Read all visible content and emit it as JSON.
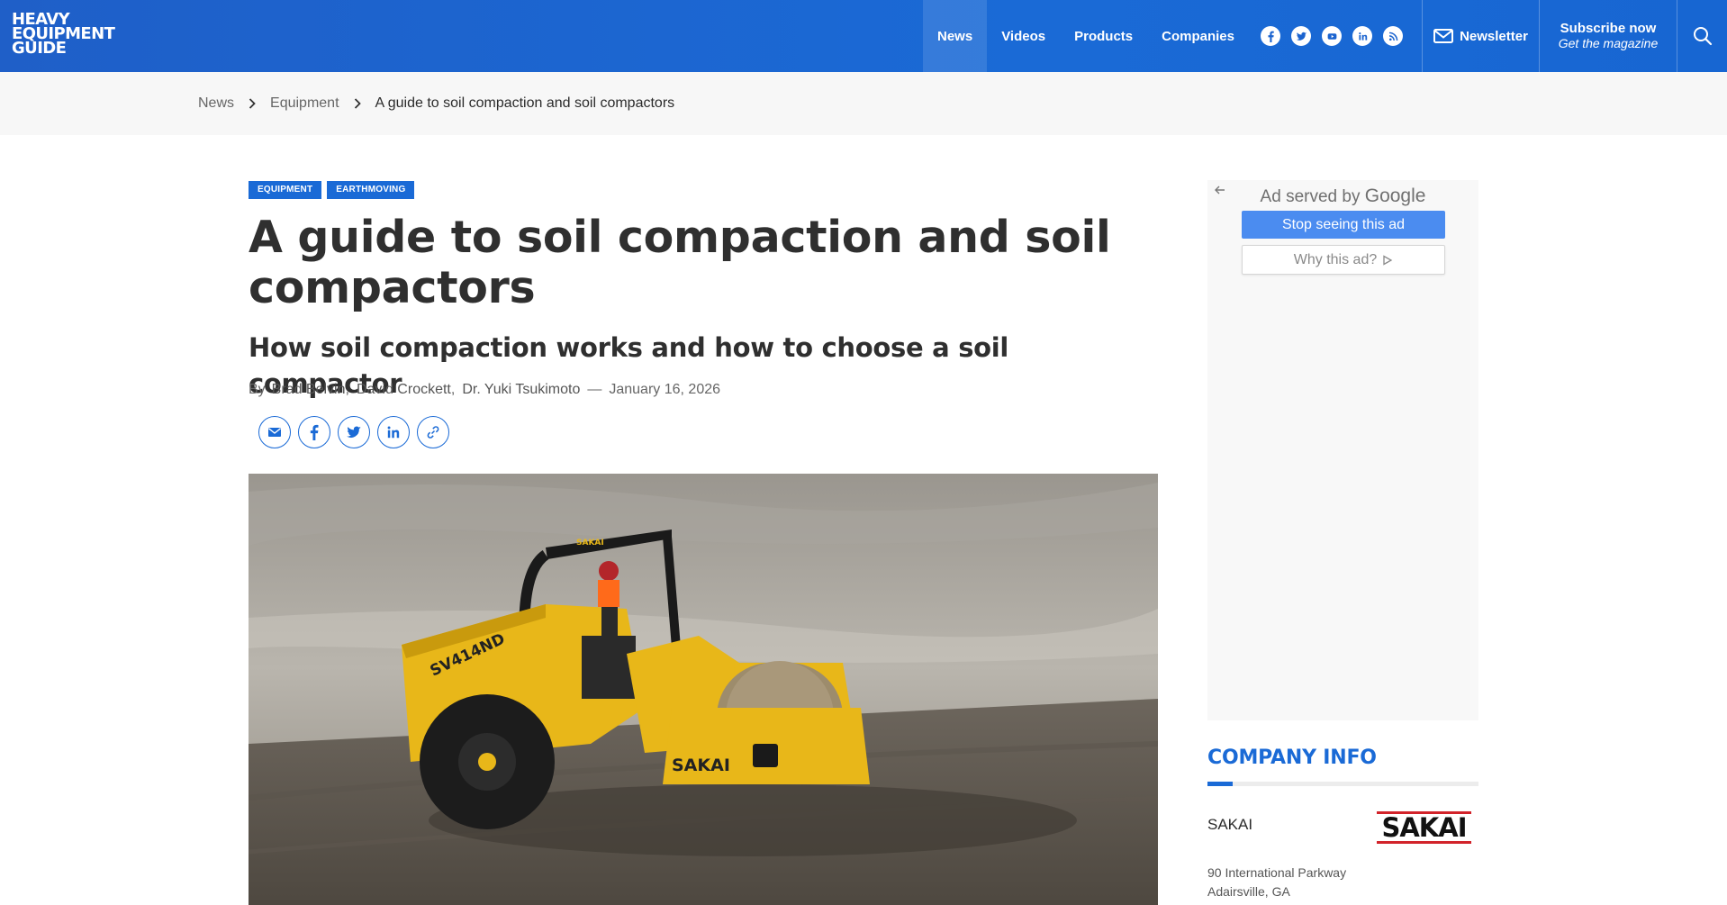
{
  "header": {
    "logo_line1": "HEAVY",
    "logo_line2": "EQUIPMENT",
    "logo_line3": "GUIDE",
    "nav": [
      {
        "label": "News",
        "active": true
      },
      {
        "label": "Videos",
        "active": false
      },
      {
        "label": "Products",
        "active": false
      },
      {
        "label": "Companies",
        "active": false
      }
    ],
    "social_icons": [
      "facebook-icon",
      "twitter-icon",
      "youtube-icon",
      "linkedin-icon",
      "rss-icon"
    ],
    "newsletter_label": "Newsletter",
    "subscribe_line1": "Subscribe now",
    "subscribe_line2": "Get the magazine",
    "accent_color": "#1a6ad6"
  },
  "breadcrumb": {
    "items": [
      "News",
      "Equipment",
      "A guide to soil compaction and soil compactors"
    ]
  },
  "article": {
    "tags": [
      "EQUIPMENT",
      "EARTHMOVING"
    ],
    "title": "A guide to soil compaction and soil compactors",
    "subtitle": "How soil compaction works and how to choose a soil compactor",
    "by_label": "By",
    "authors": [
      "Brad Belvin",
      "David Crockett",
      "Dr. Yuki Tsukimoto"
    ],
    "date": "January 16, 2026",
    "share_icons": [
      "email-icon",
      "facebook-icon",
      "twitter-icon",
      "linkedin-icon",
      "link-icon"
    ],
    "hero_image": {
      "brand_on_canopy": "SAKAI",
      "model_on_machine": "SV414ND",
      "brand_on_drum": "SAKAI",
      "machine_color": "#e8b719"
    }
  },
  "ad": {
    "served_by": "Ad served by",
    "google": "Google",
    "stop_label": "Stop seeing this ad",
    "why_label": "Why this ad?"
  },
  "company_info": {
    "heading": "COMPANY INFO",
    "name": "SAKAI",
    "logo_text": "SAKAI",
    "address_line1": "90 International Parkway",
    "address_line2": "Adairsville, GA"
  }
}
